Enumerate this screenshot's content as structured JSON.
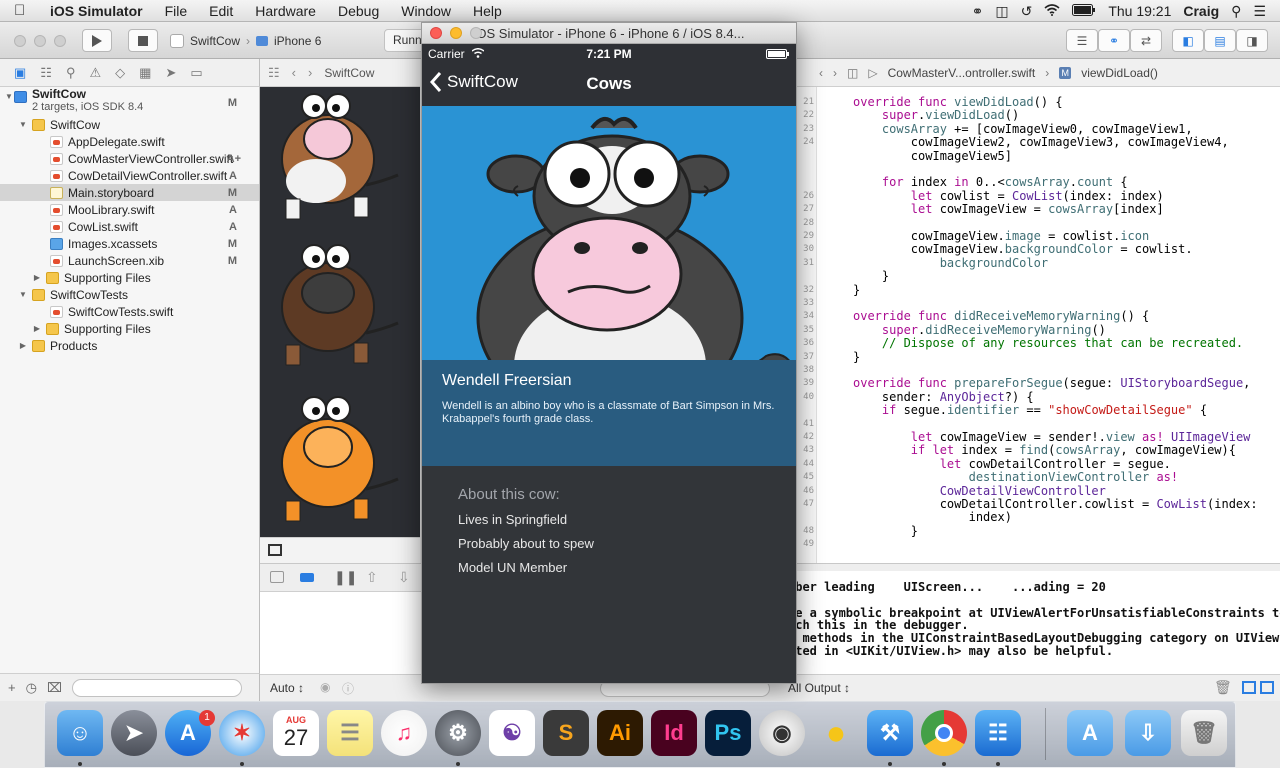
{
  "menubar": {
    "app_name": "iOS Simulator",
    "items": [
      "File",
      "Edit",
      "Hardware",
      "Debug",
      "Window",
      "Help"
    ],
    "clock": "Thu 19:21",
    "user": "Craig"
  },
  "xcode": {
    "scheme": "SwiftCow",
    "device": "iPhone 6",
    "run_status": "Runn"
  },
  "navigator": {
    "project": {
      "name": "SwiftCow",
      "subtitle": "2 targets, iOS SDK 8.4",
      "badge": "M"
    },
    "items": [
      {
        "label": "SwiftCow",
        "badge": ""
      },
      {
        "label": "AppDelegate.swift",
        "badge": ""
      },
      {
        "label": "CowMasterViewController.swift",
        "badge": "A+"
      },
      {
        "label": "CowDetailViewController.swift",
        "badge": "A"
      },
      {
        "label": "Main.storyboard",
        "badge": "M"
      },
      {
        "label": "MooLibrary.swift",
        "badge": "A"
      },
      {
        "label": "CowList.swift",
        "badge": "A"
      },
      {
        "label": "Images.xcassets",
        "badge": "M"
      },
      {
        "label": "LaunchScreen.xib",
        "badge": "M"
      },
      {
        "label": "Supporting Files",
        "badge": ""
      },
      {
        "label": "SwiftCowTests",
        "badge": ""
      },
      {
        "label": "SwiftCowTests.swift",
        "badge": ""
      },
      {
        "label": "Supporting Files",
        "badge": ""
      },
      {
        "label": "Products",
        "badge": ""
      }
    ]
  },
  "storyboard_jump": {
    "label": "SwiftCow"
  },
  "editor_jump": {
    "file": "CowMasterV...ontroller.swift",
    "symbol": "viewDidLoad()"
  },
  "line_numbers": [
    "21",
    "22",
    "23",
    "24",
    "",
    "",
    "",
    "26",
    "27",
    "28",
    "29",
    "30",
    "31",
    "",
    "32",
    "33",
    "34",
    "35",
    "36",
    "37",
    "38",
    "39",
    "40",
    "",
    "41",
    "42",
    "43",
    "44",
    "45",
    "46",
    "47",
    "",
    "48",
    "49"
  ],
  "code_lines": [
    "override func viewDidLoad() {",
    "    super.viewDidLoad()",
    "    cowsArray += [cowImageView0, cowImageView1,",
    "        cowImageView2, cowImageView3, cowImageView4,",
    "        cowImageView5]",
    "",
    "    for index in 0..<cowsArray.count {",
    "        let cowlist = CowList(index: index)",
    "        let cowImageView = cowsArray[index]",
    "",
    "        cowImageView.image = cowlist.icon",
    "        cowImageView.backgroundColor = cowlist.",
    "            backgroundColor",
    "    }",
    "}",
    "",
    "override func didReceiveMemoryWarning() {",
    "    super.didReceiveMemoryWarning()",
    "    // Dispose of any resources that can be recreated.",
    "}",
    "",
    "override func prepareForSegue(segue: UIStoryboardSegue,",
    "    sender: AnyObject?) {",
    "    if segue.identifier == \"showCowDetailSegue\" {",
    "",
    "        let cowImageView = sender!.view as! UIImageView",
    "        if let index = find(cowsArray, cowImageView){",
    "            let cowDetailController = segue.",
    "                destinationViewController as!",
    "            CowDetailViewController",
    "            cowDetailController.cowlist = CowList(index:",
    "                index)",
    "        }"
  ],
  "console_lines": [
    "mber leading    UIScreen...    ...ading = 20",
    "",
    "ke a symbolic breakpoint at UIViewAlertForUnsatisfiableConstraints to",
    "tch this in the debugger.",
    "e methods in the UIConstraintBasedLayoutDebugging category on UIView",
    "sted in <UIKit/UIView.h> may also be helpful."
  ],
  "debug_footer": {
    "auto_label": "Auto ↕",
    "output_label": "All Output ↕"
  },
  "simulator": {
    "window_title": "iOS Simulator - iPhone 6 - iPhone 6 / iOS 8.4...",
    "carrier": "Carrier",
    "time": "7:21 PM",
    "back_label": "SwiftCow",
    "nav_title": "Cows",
    "cow_name": "Wendell Freersian",
    "cow_description": "Wendell is an albino boy who is a classmate of Bart Simpson in Mrs. Krabappel's fourth grade class.",
    "about_heading": "About this cow:",
    "facts": [
      "Lives in Springfield",
      "Probably about to spew",
      "Model UN Member"
    ]
  },
  "dock": {
    "badge_count": "1",
    "calendar_month": "AUG",
    "calendar_day": "27",
    "ai_label": "Ai",
    "id_label": "Id",
    "ps_label": "Ps"
  }
}
